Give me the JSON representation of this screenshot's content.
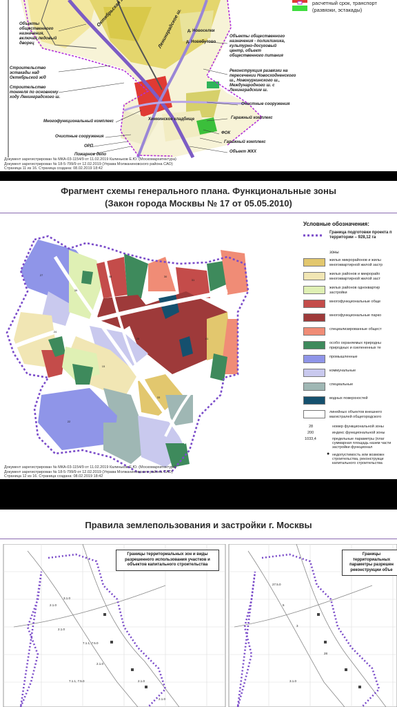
{
  "page1": {
    "legend_top": {
      "label1": "расчетный срок, транспорт",
      "label2": "(развязки, эстакады)"
    },
    "labels": {
      "sport": "Объекты общественного назначения, включая ледовый дворец",
      "overpass": "Строительство эстакады над Октябрьской ж/д",
      "tunnel": "Строительство тоннеля по основному ходу Ленинградского ш.",
      "multi": "Многофункциональный комплекс",
      "treat_left": "Очистные сооружения",
      "orp": "ОРП",
      "fire": "Пожарное депо",
      "public": "Объекты общественного назначения - поликлиника, культурно-досуговый центр, объект общественного питания",
      "reconstr": "Реконструкция развязки на пересечении Новосходненского ш., Новокуркинского ш., Международного ш. с Ленинградским ш.",
      "treat_right": "Очистные сооружения",
      "garage_complex": "Гаражный комплекс",
      "fok": "ФОК",
      "garage": "Гаражный комплекс",
      "housing": "Объект ЖКХ",
      "rail": "Октябрьская ж/д",
      "highway": "Ленинградское ш.",
      "novosel": "д. Новоселки",
      "novobutovo": "д. Новобутово",
      "cemetery": "Химкинское кладбище"
    },
    "footer": [
      "Документ зарегистрирован № МКА-03-1154/9 от 11.02.2019 Калиньков Е.Ю. (Москомархитектура)",
      "Документ зарегистрирован № 18-5-799/9 от 12.02.2019 (Управа Молжаниновского района САО)",
      "Страница 11 из 16. Страница создана: 08.02.2019 18:42"
    ]
  },
  "page2": {
    "title_line1": "Фрагмент схемы генерального плана. Функциональные зоны",
    "title_line2": "(Закон города Москвы № 17 от 05.05.2010)",
    "legend_title": "Условные обозначения:",
    "boundary_label": "Граница подготовки проекта п территории – 928,12 га",
    "zones_label": "зоны",
    "legend": [
      {
        "color": "#e2c76e",
        "text": "жилых микрорайонов и жилы многоквартирной жилой застр"
      },
      {
        "color": "#f1e6b4",
        "text": "жилых районов и микрорайо многоквартирной жилой заст"
      },
      {
        "color": "#dff0b4",
        "text": "жилых районов одноквартир застройки"
      },
      {
        "color": "#c44c4a",
        "text": "многофункциональные обще"
      },
      {
        "color": "#9e3a3a",
        "text": "многофункциональные парко"
      },
      {
        "color": "#f08c76",
        "text": "специализированные общест"
      },
      {
        "color": "#3e8a5c",
        "text": "особо охраняемых природны природных и озелененных те"
      },
      {
        "color": "#8f95e8",
        "text": "промышленные"
      },
      {
        "color": "#c9c9ee",
        "text": "коммунальные"
      },
      {
        "color": "#9fb7b4",
        "text": "специальные"
      },
      {
        "color": "#15506e",
        "text": "водных поверхностей"
      },
      {
        "color": "#ffffff",
        "text": "линейных объектов внешнего магистралей общегородского"
      }
    ],
    "index": [
      {
        "num": "28",
        "text": "номер функциональной зоны"
      },
      {
        "num": "200",
        "text": "индекс функциональной зоны"
      },
      {
        "num": "1033,4",
        "text": "предельные параметры (плаг суммарная площадь назем части застройки функционал"
      }
    ],
    "restriction": "недопустимость или возможн строительства, реконструкци капитального строительства",
    "footer": [
      "Документ зарегистрирован № МКА-03-1154/9 от 11.02.2019 Калиньков Е.Ю. (Москомархитектура)",
      "Документ зарегистрирован № 18-5-799/9 от 12.02.2019 (Управа Молжаниновского района САО)",
      "Страница 12 из 16. Страница создана: 08.02.2019 18:42"
    ]
  },
  "page3": {
    "title": "Правила землепользования и застройки г. Москвы",
    "callout_left": "Границы территориальных зон и виды разрешенного использования участков и объектов капитального строительства",
    "callout_right": "Границы территориальных параметры разрешен реконструкции объе"
  }
}
